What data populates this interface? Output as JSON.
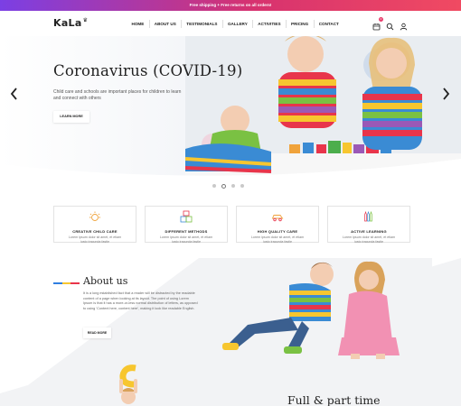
{
  "promo": {
    "text": "Free shipping + Free returns on all orders!"
  },
  "header": {
    "logo": "KaLa",
    "nav": [
      {
        "label": "HOME"
      },
      {
        "label": "ABOUT US"
      },
      {
        "label": "TESTIMONIALS"
      },
      {
        "label": "GALLERY"
      },
      {
        "label": "ACTIVITIES"
      },
      {
        "label": "PRICING"
      },
      {
        "label": "CONTACT"
      }
    ],
    "icons": [
      "calendar-icon",
      "search-icon",
      "user-icon"
    ],
    "cart_badge": "0"
  },
  "hero": {
    "title": "Coronavirus (COVID-19)",
    "text": "Child care and schools are important places for children to learn and connect with others",
    "button": "LEARN MORE",
    "slides": 4,
    "active_slide": 2
  },
  "features": [
    {
      "icon": "sun-icon",
      "title": "CREATIVE CHILD CARE",
      "text": "Lorem ipsum dolor sit amet, et etiam iusto iracunda fastie"
    },
    {
      "icon": "blocks-icon",
      "title": "DIFFERENT METHODS",
      "text": "Lorem ipsum dolor sit amet, et etiam iusto iracunda fastie"
    },
    {
      "icon": "car-icon",
      "title": "HIGH QUALITY CARE",
      "text": "Lorem ipsum dolor sit amet, et etiam iusto iracunda fastie"
    },
    {
      "icon": "crayons-icon",
      "title": "ACTIVE LEARNING",
      "text": "Lorem ipsum dolor sit amet, et etiam iusto iracunda fastie"
    }
  ],
  "about": {
    "title": "About us",
    "text": "It is a long established fact that a reader will be distracted by the readable content of a page when looking at its layout. The point of using Lorem Ipsum is that it has a more-or-less normal distribution of letters, as opposed to using 'Content here, content here', making it look like readable English.",
    "button": "READ MORE"
  },
  "next_section": {
    "title": "Full & part time"
  },
  "colors": {
    "accent_pink": "#e83e6c",
    "accent_purple": "#7b3fe4",
    "stripe_blue": "#2f7ee0",
    "stripe_yellow": "#f7c62f",
    "stripe_red": "#e8354b"
  }
}
